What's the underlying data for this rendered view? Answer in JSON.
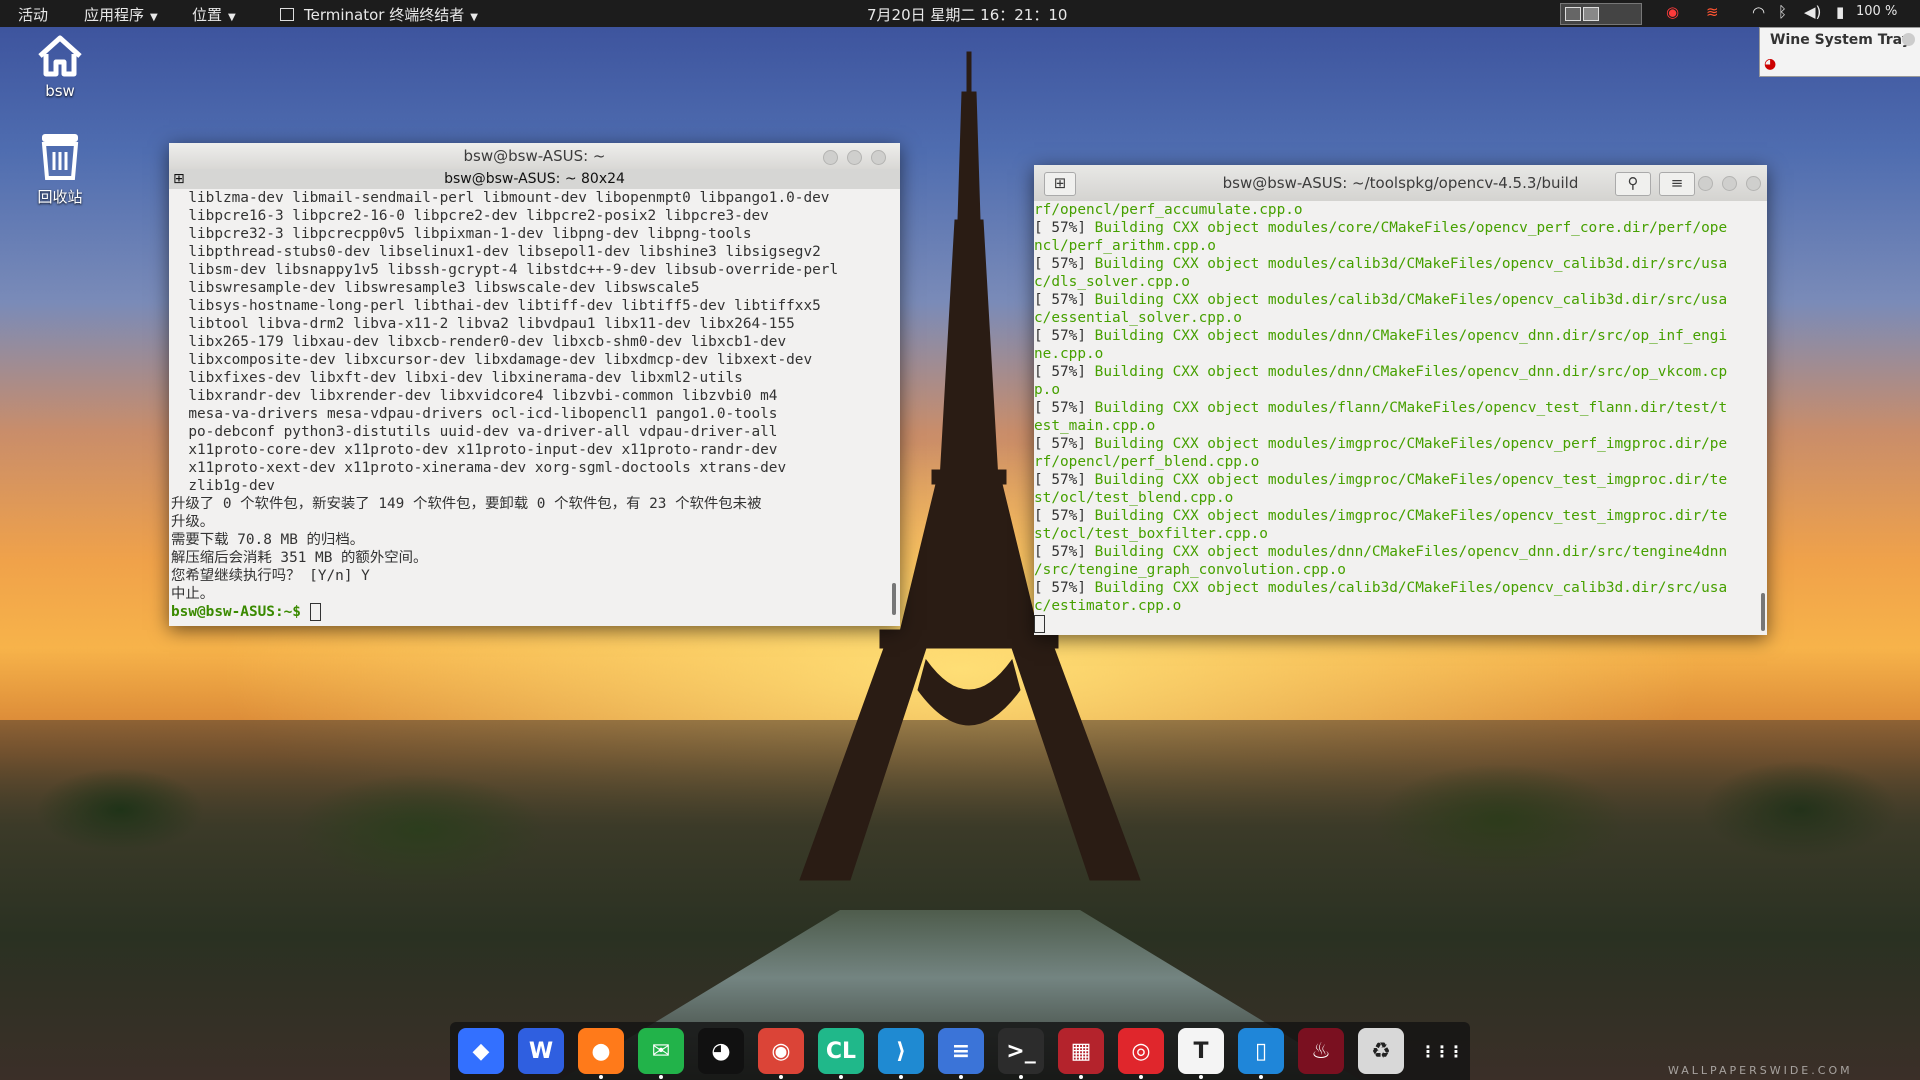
{
  "topbar": {
    "activities": "活动",
    "applications": "应用程序",
    "places": "位置",
    "app_menu": "Terminator 终端终结者",
    "clock": "7月20日 星期二  16：21：10",
    "battery": "100 %"
  },
  "desktop": {
    "home_label": "bsw",
    "trash_label": "回收站"
  },
  "tray_popup": {
    "title": "Wine System Tray"
  },
  "left_terminal": {
    "title": "bsw@bsw-ASUS: ~",
    "tab_title": "bsw@bsw-ASUS: ~ 80x24",
    "lines": [
      "  liblzma-dev libmail-sendmail-perl libmount-dev libopenmpt0 libpango1.0-dev",
      "  libpcre16-3 libpcre2-16-0 libpcre2-dev libpcre2-posix2 libpcre3-dev",
      "  libpcre32-3 libpcrecpp0v5 libpixman-1-dev libpng-dev libpng-tools",
      "  libpthread-stubs0-dev libselinux1-dev libsepol1-dev libshine3 libsigsegv2",
      "  libsm-dev libsnappy1v5 libssh-gcrypt-4 libstdc++-9-dev libsub-override-perl",
      "  libswresample-dev libswresample3 libswscale-dev libswscale5",
      "  libsys-hostname-long-perl libthai-dev libtiff-dev libtiff5-dev libtiffxx5",
      "  libtool libva-drm2 libva-x11-2 libva2 libvdpau1 libx11-dev libx264-155",
      "  libx265-179 libxau-dev libxcb-render0-dev libxcb-shm0-dev libxcb1-dev",
      "  libxcomposite-dev libxcursor-dev libxdamage-dev libxdmcp-dev libxext-dev",
      "  libxfixes-dev libxft-dev libxi-dev libxinerama-dev libxml2-utils",
      "  libxrandr-dev libxrender-dev libxvidcore4 libzvbi-common libzvbi0 m4",
      "  mesa-va-drivers mesa-vdpau-drivers ocl-icd-libopencl1 pango1.0-tools",
      "  po-debconf python3-distutils uuid-dev va-driver-all vdpau-driver-all",
      "  x11proto-core-dev x11proto-dev x11proto-input-dev x11proto-randr-dev",
      "  x11proto-xext-dev x11proto-xinerama-dev xorg-sgml-doctools xtrans-dev",
      "  zlib1g-dev",
      "升级了 0 个软件包，新安装了 149 个软件包，要卸载 0 个软件包，有 23 个软件包未被",
      "升级。",
      "需要下载 70.8 MB 的归档。",
      "解压缩后会消耗 351 MB 的额外空间。",
      "您希望继续执行吗？ [Y/n] Y",
      "中止。"
    ],
    "prompt": "bsw@bsw-ASUS:~$ "
  },
  "right_terminal": {
    "title": "bsw@bsw-ASUS: ~/toolspkg/opencv-4.5.3/build",
    "first_line": "rf/opencl/perf_accumulate.cpp.o",
    "build_lines": [
      {
        "pct": "[ 57%] ",
        "msg": "Building CXX object modules/core/CMakeFiles/opencv_perf_core.dir/perf/ope",
        "cont": "ncl/perf_arithm.cpp.o"
      },
      {
        "pct": "[ 57%] ",
        "msg": "Building CXX object modules/calib3d/CMakeFiles/opencv_calib3d.dir/src/usa",
        "cont": "c/dls_solver.cpp.o"
      },
      {
        "pct": "[ 57%] ",
        "msg": "Building CXX object modules/calib3d/CMakeFiles/opencv_calib3d.dir/src/usa",
        "cont": "c/essential_solver.cpp.o"
      },
      {
        "pct": "[ 57%] ",
        "msg": "Building CXX object modules/dnn/CMakeFiles/opencv_dnn.dir/src/op_inf_engi",
        "cont": "ne.cpp.o"
      },
      {
        "pct": "[ 57%] ",
        "msg": "Building CXX object modules/dnn/CMakeFiles/opencv_dnn.dir/src/op_vkcom.cp",
        "cont": "p.o"
      },
      {
        "pct": "[ 57%] ",
        "msg": "Building CXX object modules/flann/CMakeFiles/opencv_test_flann.dir/test/t",
        "cont": "est_main.cpp.o"
      },
      {
        "pct": "[ 57%] ",
        "msg": "Building CXX object modules/imgproc/CMakeFiles/opencv_perf_imgproc.dir/pe",
        "cont": "rf/opencl/perf_blend.cpp.o"
      },
      {
        "pct": "[ 57%] ",
        "msg": "Building CXX object modules/imgproc/CMakeFiles/opencv_test_imgproc.dir/te",
        "cont": "st/ocl/test_blend.cpp.o"
      },
      {
        "pct": "[ 57%] ",
        "msg": "Building CXX object modules/imgproc/CMakeFiles/opencv_test_imgproc.dir/te",
        "cont": "st/ocl/test_boxfilter.cpp.o"
      },
      {
        "pct": "[ 57%] ",
        "msg": "Building CXX object modules/dnn/CMakeFiles/opencv_dnn.dir/src/tengine4dnn",
        "cont": "/src/tengine_graph_convolution.cpp.o"
      },
      {
        "pct": "[ 57%] ",
        "msg": "Building CXX object modules/calib3d/CMakeFiles/opencv_calib3d.dir/src/usa",
        "cont": "c/estimator.cpp.o"
      }
    ]
  },
  "dock": {
    "items": [
      {
        "name": "feishu-icon",
        "glyph": "◆",
        "color": "#3370ff"
      },
      {
        "name": "wps-icon",
        "glyph": "W",
        "color": "#2f5fe0"
      },
      {
        "name": "firefox-icon",
        "glyph": "●",
        "color": "#ff7a1a"
      },
      {
        "name": "wechat-icon",
        "glyph": "✉",
        "color": "#22b34a"
      },
      {
        "name": "qq-icon",
        "glyph": "◕",
        "color": "#111111"
      },
      {
        "name": "chrome-icon",
        "glyph": "◉",
        "color": "#db4437"
      },
      {
        "name": "clion-icon",
        "glyph": "CL",
        "color": "#20b88a"
      },
      {
        "name": "vscode-icon",
        "glyph": "⟩",
        "color": "#1f8ad2"
      },
      {
        "name": "text-editor-icon",
        "glyph": "≡",
        "color": "#3b74d8"
      },
      {
        "name": "terminal-icon",
        "glyph": ">_",
        "color": "#2c2c2c"
      },
      {
        "name": "terminator-icon",
        "glyph": "▦",
        "color": "#b4232c"
      },
      {
        "name": "netease-music-icon",
        "glyph": "◎",
        "color": "#e0262c"
      },
      {
        "name": "typora-icon",
        "glyph": "T",
        "color": "#f4f4f4"
      },
      {
        "name": "tablet-icon",
        "glyph": "▯",
        "color": "#1f86d9"
      },
      {
        "name": "wine-icon",
        "glyph": "♨",
        "color": "#7a1020"
      },
      {
        "name": "trash-icon",
        "glyph": "♻",
        "color": "#d8d8d8"
      },
      {
        "name": "show-apps-icon",
        "glyph": "⋮⋮⋮",
        "color": "#333333"
      }
    ]
  },
  "watermark": "WALLPAPERSWIDE.COM"
}
